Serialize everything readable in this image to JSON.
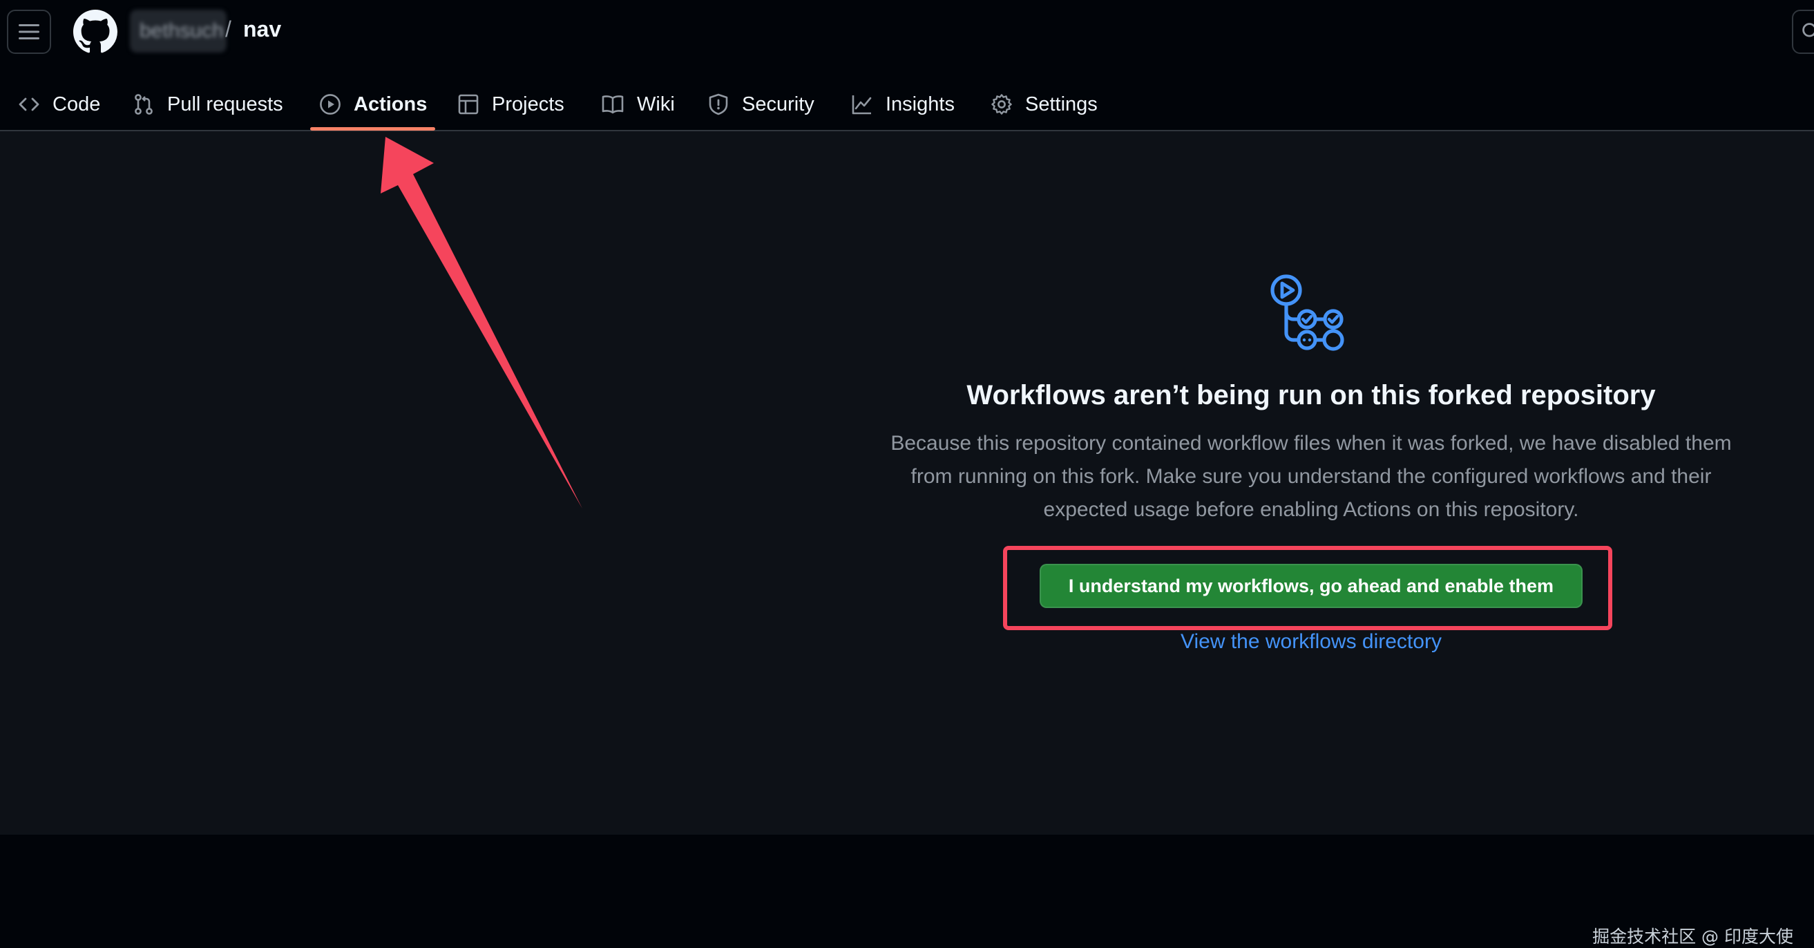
{
  "header": {
    "owner": "bethsuch",
    "separator": "/",
    "repo": "nav",
    "menu_icon": "hamburger-icon",
    "logo_icon": "github-logo-icon",
    "search_icon": "search-icon"
  },
  "tabs": [
    {
      "label": "Code",
      "icon": "code-icon"
    },
    {
      "label": "Pull requests",
      "icon": "git-pull-request-icon"
    },
    {
      "label": "Actions",
      "icon": "play-icon",
      "active": true
    },
    {
      "label": "Projects",
      "icon": "table-icon"
    },
    {
      "label": "Wiki",
      "icon": "book-icon"
    },
    {
      "label": "Security",
      "icon": "shield-icon"
    },
    {
      "label": "Insights",
      "icon": "graph-icon"
    },
    {
      "label": "Settings",
      "icon": "gear-icon"
    }
  ],
  "main": {
    "icon": "workflow-icon",
    "title": "Workflows aren’t being run on this forked repository",
    "description_lines": [
      "Because this repository contained workflow files when it was forked, we have disabled them",
      "from running on this fork. Make sure you understand the configured workflows and their",
      "expected usage before enabling Actions on this repository."
    ],
    "enable_button": "I understand my workflows, go ahead and enable them",
    "workflows_link": "View the workflows directory"
  },
  "watermark": "掘金技术社区 @ 印度大使",
  "colors": {
    "header_bg": "#010409",
    "main_bg": "#0d1117",
    "active_underline": "#f78166",
    "button_bg": "#238636",
    "link": "#4493f8",
    "annotation": "#f5455c",
    "icon_accent": "#4493f8"
  }
}
